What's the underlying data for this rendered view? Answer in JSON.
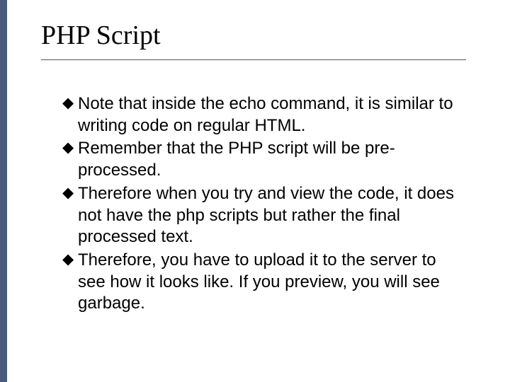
{
  "title": "PHP Script",
  "bullets": [
    "Note that inside the echo command, it is similar to writing code on regular HTML.",
    "Remember that the PHP script will be pre-processed.",
    "Therefore when you try and view the code, it does not have the php scripts but rather the final processed text.",
    "Therefore, you have to upload it to the server to see how it looks like. If you preview, you will see garbage."
  ]
}
